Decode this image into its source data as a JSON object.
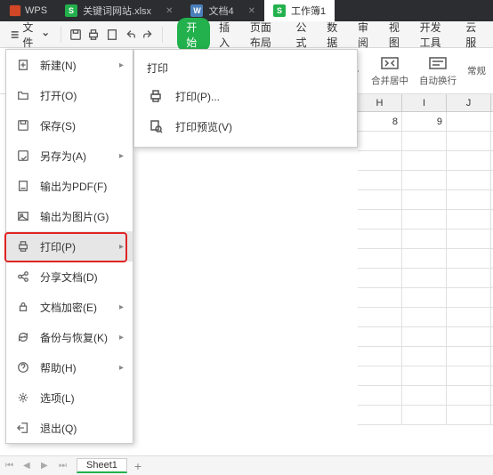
{
  "titlebar": {
    "brand": "WPS",
    "tabs": [
      {
        "icon": "s",
        "label": "关键词网站.xlsx",
        "active": false
      },
      {
        "icon": "w",
        "label": "文档4",
        "active": false
      },
      {
        "icon": "s",
        "label": "工作簿1",
        "active": true
      }
    ]
  },
  "toolbar": {
    "file_label": "文件",
    "ribbon_tabs": {
      "start": "开始",
      "insert": "插入",
      "page": "页面布局",
      "formula": "公式",
      "data": "数据",
      "review": "审阅",
      "view": "视图",
      "dev": "开发工具",
      "cloud": "云服"
    }
  },
  "ribbon": {
    "format_label": "常规",
    "merge_label": "合并居中",
    "wrap_label": "自动换行"
  },
  "filemenu": {
    "items": [
      {
        "key": "new",
        "label": "新建(N)",
        "arrow": true
      },
      {
        "key": "open",
        "label": "打开(O)"
      },
      {
        "key": "save",
        "label": "保存(S)"
      },
      {
        "key": "saveas",
        "label": "另存为(A)",
        "arrow": true
      },
      {
        "key": "pdf",
        "label": "输出为PDF(F)"
      },
      {
        "key": "image",
        "label": "输出为图片(G)"
      },
      {
        "key": "print",
        "label": "打印(P)",
        "arrow": true,
        "selected": true
      },
      {
        "key": "share",
        "label": "分享文档(D)"
      },
      {
        "key": "encrypt",
        "label": "文档加密(E)",
        "arrow": true
      },
      {
        "key": "backup",
        "label": "备份与恢复(K)",
        "arrow": true
      },
      {
        "key": "help",
        "label": "帮助(H)",
        "arrow": true
      },
      {
        "key": "options",
        "label": "选项(L)"
      },
      {
        "key": "exit",
        "label": "退出(Q)"
      }
    ]
  },
  "submenu": {
    "title": "打印",
    "print_item": "打印(P)...",
    "preview_item": "打印预览(V)"
  },
  "grid": {
    "columns": [
      "H",
      "I",
      "J"
    ],
    "cells": {
      "H1": "8",
      "I1": "9"
    }
  },
  "sheetbar": {
    "sheet": "Sheet1"
  }
}
